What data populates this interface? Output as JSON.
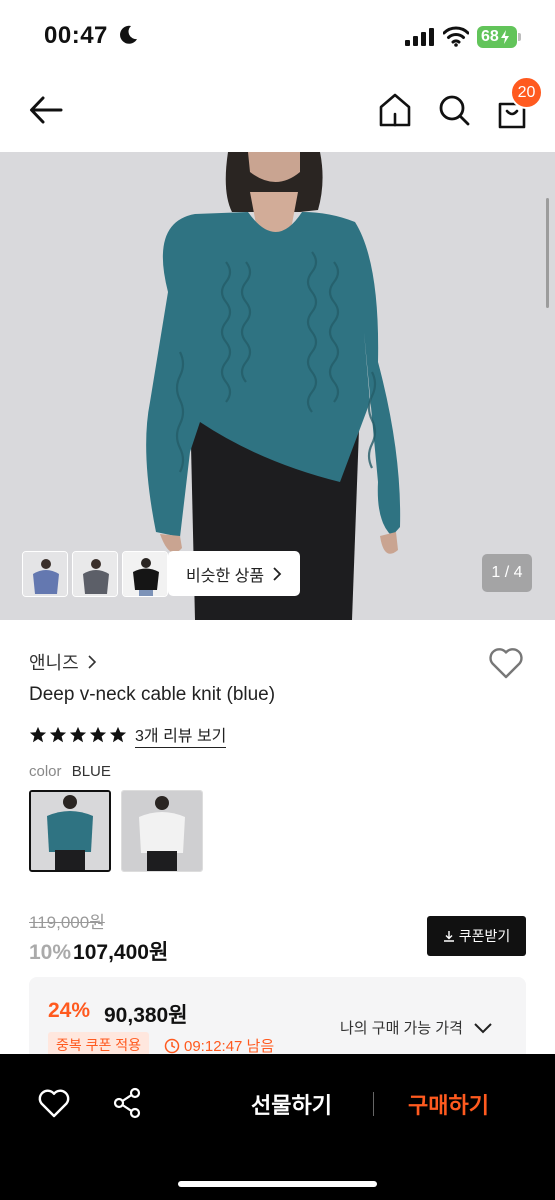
{
  "status_bar": {
    "time": "00:47",
    "battery": "68"
  },
  "header": {
    "cart_count": "20"
  },
  "gallery": {
    "similar_label": "비슷한 상품",
    "counter": "1 / 4"
  },
  "product": {
    "brand": "앤니즈",
    "title": "Deep v-neck cable knit (blue)",
    "rating": 5,
    "review_link": "3개 리뷰 보기",
    "color_label": "color",
    "color_value": "BLUE",
    "original_price": "119,000원",
    "discount_rate": "10%",
    "sale_price": "107,400원",
    "coupon_button": "쿠폰받기"
  },
  "my_price": {
    "discount_rate": "24%",
    "price": "90,380원",
    "label": "나의 구매 가능 가격",
    "tag": "중복 쿠폰 적용",
    "timer": "09:12:47 남음"
  },
  "bottom_bar": {
    "gift_label": "선물하기",
    "buy_label": "구매하기"
  },
  "colors": {
    "accent": "#ff5a1f",
    "sweater": "#2f7382",
    "background_photo": "#d9d9dc"
  }
}
